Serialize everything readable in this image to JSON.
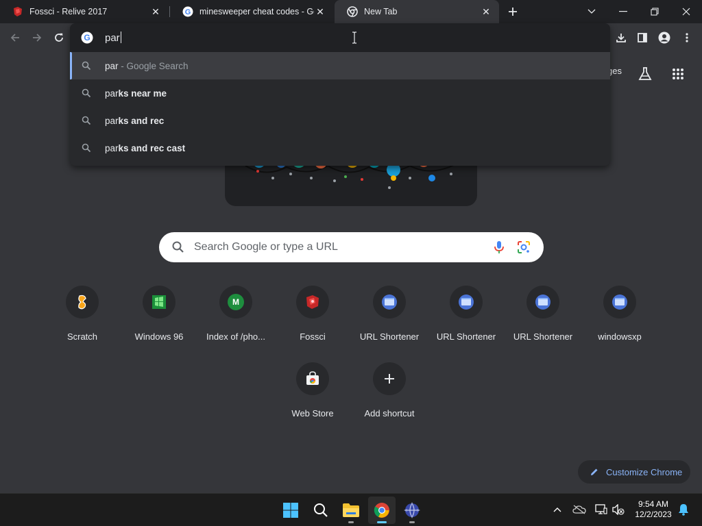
{
  "tabs": [
    {
      "title": "Fossci - Relive 2017",
      "favicon": "fossci-icon",
      "active": false
    },
    {
      "title": "minesweeper cheat codes - Goog",
      "favicon": "google-icon",
      "active": false
    },
    {
      "title": "New Tab",
      "favicon": "chrome-icon",
      "active": true
    }
  ],
  "omnibox": {
    "typed": "par",
    "suggestions": [
      {
        "prefix": "par",
        "rest": "",
        "suffix": " - Google Search"
      },
      {
        "prefix": "par",
        "rest": "ks near me",
        "suffix": ""
      },
      {
        "prefix": "par",
        "rest": "ks and rec",
        "suffix": ""
      },
      {
        "prefix": "par",
        "rest": "ks and rec cast",
        "suffix": ""
      }
    ]
  },
  "header_links": {
    "images_partial": "ges"
  },
  "search": {
    "placeholder": "Search Google or type a URL"
  },
  "shortcuts": [
    {
      "label": "Scratch",
      "icon": "scratch-icon"
    },
    {
      "label": "Windows 96",
      "icon": "windows96-icon"
    },
    {
      "label": "Index of /pho...",
      "icon": "letter-m-icon",
      "letter": "M"
    },
    {
      "label": "Fossci",
      "icon": "fossci-icon"
    },
    {
      "label": "URL Shortener",
      "icon": "globe-icon"
    },
    {
      "label": "URL Shortener",
      "icon": "globe-icon"
    },
    {
      "label": "URL Shortener",
      "icon": "globe-icon"
    },
    {
      "label": "windowsxp",
      "icon": "globe-icon"
    },
    {
      "label": "Web Store",
      "icon": "webstore-icon"
    },
    {
      "label": "Add shortcut",
      "icon": "plus-icon"
    }
  ],
  "customize": {
    "label": "Customize Chrome"
  },
  "taskbar": {
    "time": "9:54 AM",
    "date": "12/2/2023"
  },
  "colors": {
    "accent": "#8ab4f8",
    "background": "#35363a",
    "tabstrip": "#202124",
    "taskbar": "#1c1c1c"
  }
}
